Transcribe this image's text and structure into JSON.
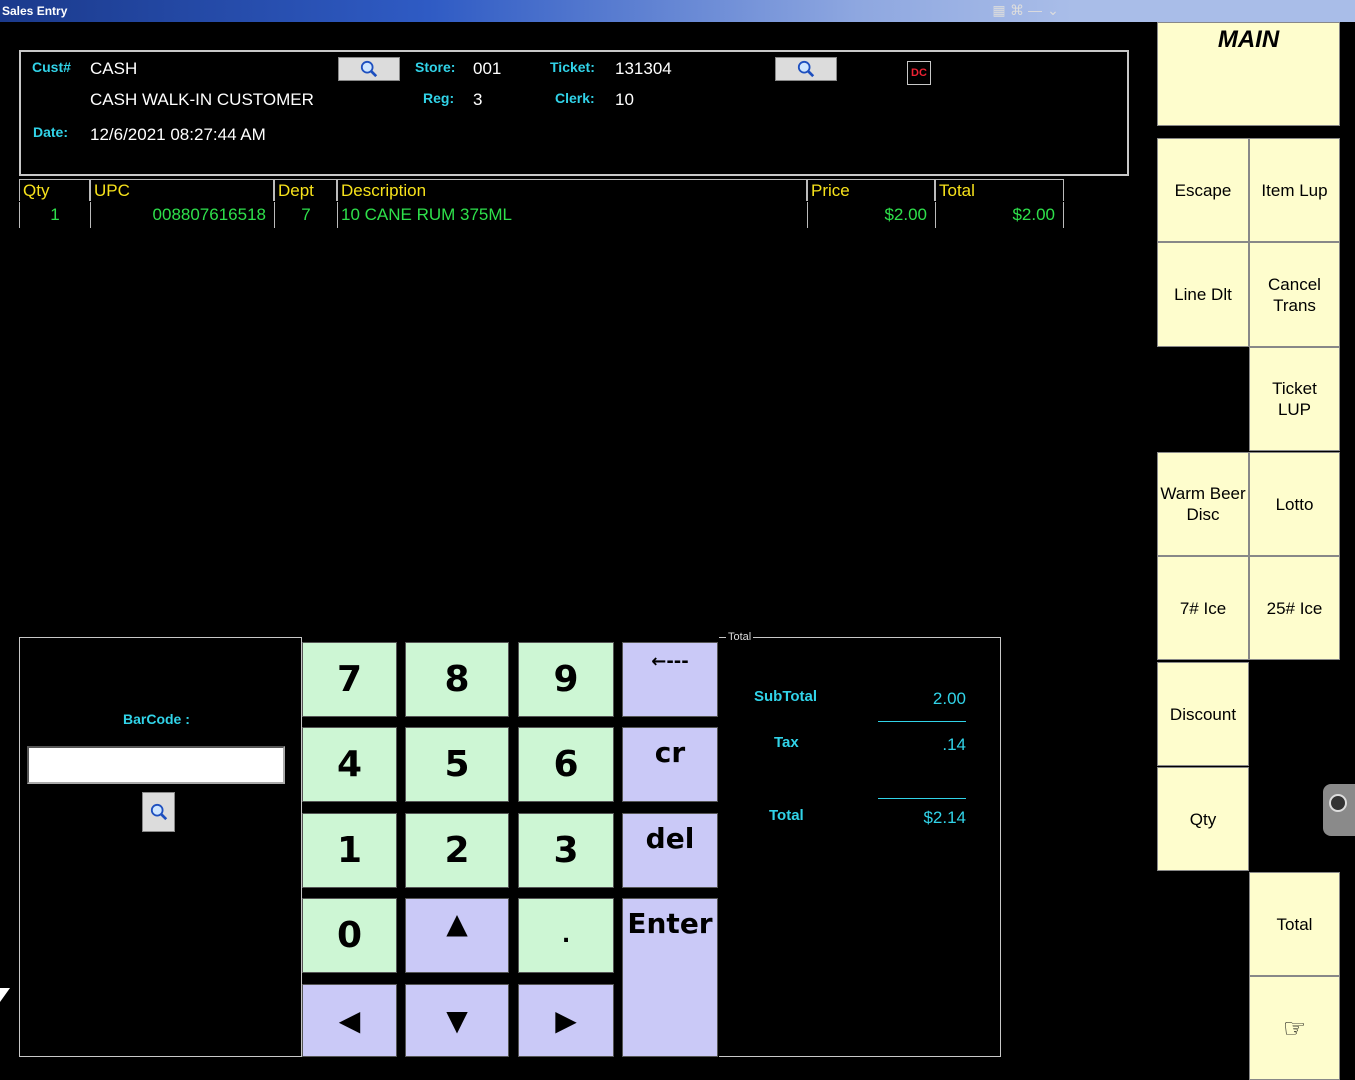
{
  "window": {
    "title": "Sales Entry"
  },
  "header": {
    "cust_label": "Cust#",
    "cust_value": "CASH",
    "cust_name": "CASH WALK-IN CUSTOMER",
    "date_label": "Date:",
    "date_value": "12/6/2021  08:27:44 AM",
    "store_label": "Store:",
    "store_value": "001",
    "reg_label": "Reg:",
    "reg_value": "3",
    "ticket_label": "Ticket:",
    "ticket_value": "131304",
    "clerk_label": "Clerk:",
    "clerk_value": "10",
    "dc_badge": "DC"
  },
  "items_table": {
    "columns": [
      "Qty",
      "UPC",
      "Dept",
      "Description",
      "Price",
      "Total"
    ],
    "rows": [
      {
        "qty": "1",
        "upc": "008807616518",
        "dept": "7",
        "description": "10 CANE RUM 375ML",
        "price": "$2.00",
        "total": "$2.00"
      }
    ]
  },
  "barcode": {
    "label": "BarCode :",
    "value": ""
  },
  "keypad": {
    "k7": "7",
    "k8": "8",
    "k9": "9",
    "back": "←---",
    "k4": "4",
    "k5": "5",
    "k6": "6",
    "cr": "cr",
    "k1": "1",
    "k2": "2",
    "k3": "3",
    "del": "del",
    "k0": "0",
    "up": "▲",
    "dot": ".",
    "enter": "Enter",
    "left": "◀",
    "down": "▼",
    "right": "▶"
  },
  "totals": {
    "legend": "Total",
    "subtotal_label": "SubTotal",
    "subtotal_value": "2.00",
    "tax_label": "Tax",
    "tax_value": ".14",
    "total_label": "Total",
    "total_value": "$2.14"
  },
  "functions": {
    "main": "MAIN",
    "escape": "Escape",
    "item_lup": "Item Lup",
    "line_dlt": "Line Dlt",
    "cancel_trans": "Cancel Trans",
    "ticket_lup": "Ticket LUP",
    "warm_beer_disc": "Warm Beer Disc",
    "lotto": "Lotto",
    "ice7": "7# Ice",
    "ice25": "25# Ice",
    "discount": "Discount",
    "qty": "Qty",
    "total": "Total",
    "pointer": "☞"
  },
  "colors": {
    "label_cyan": "#31d3e8",
    "header_yellow": "#f7e21b",
    "item_green": "#2ee04b",
    "key_green": "#cdf6d4",
    "key_blue": "#cac9f7",
    "func_yellow": "#fefdcd"
  }
}
